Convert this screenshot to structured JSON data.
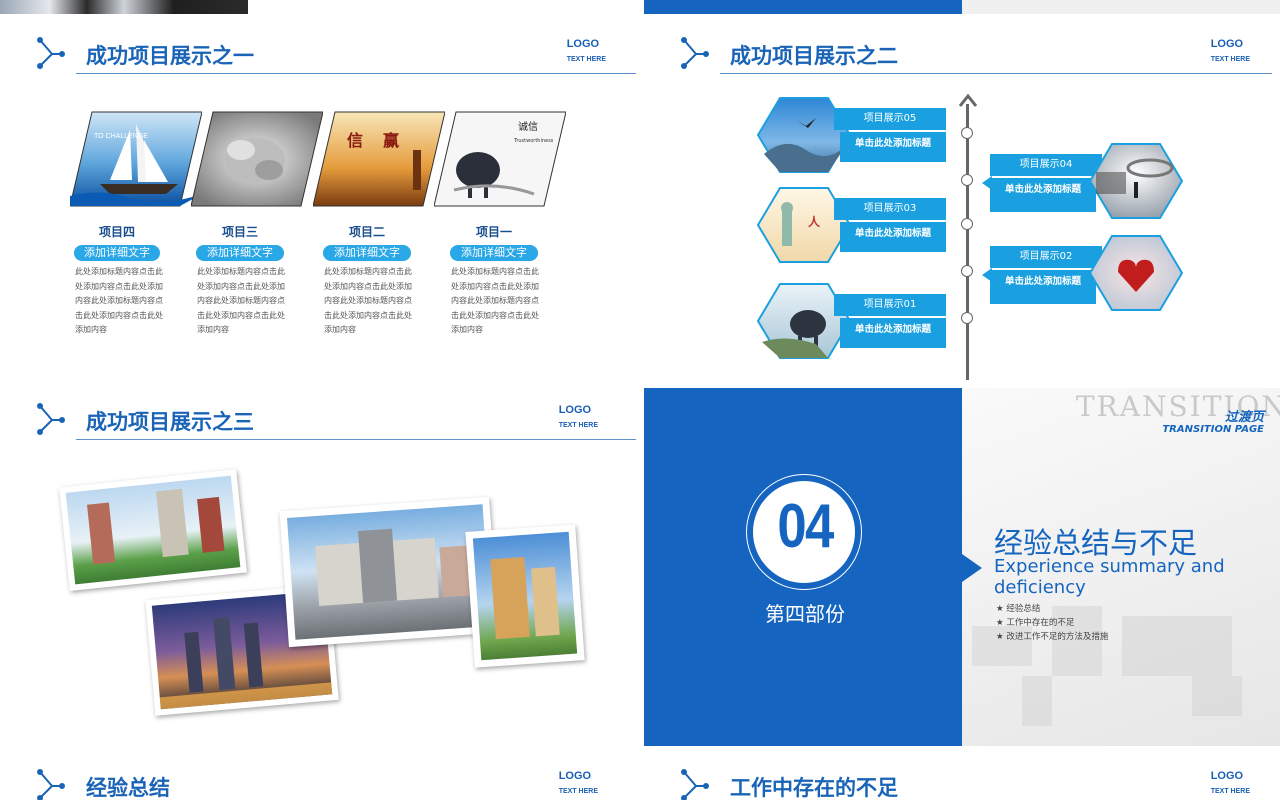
{
  "slide1": {
    "title": "成功项目展示之一",
    "logo": "LOGO",
    "logo_sub": "TEXT HERE",
    "items": [
      {
        "name": "项目四",
        "pill": "添加详细文字",
        "desc": "此处添加标题内容点击此处添加内容点击此处添加内容此处添加标题内容点击此处添加内容点击此处添加内容"
      },
      {
        "name": "项目三",
        "pill": "添加详细文字",
        "desc": "此处添加标题内容点击此处添加内容点击此处添加内容此处添加标题内容点击此处添加内容点击此处添加内容"
      },
      {
        "name": "项目二",
        "pill": "添加详细文字",
        "desc": "此处添加标题内容点击此处添加内容点击此处添加内容此处添加标题内容点击此处添加内容点击此处添加内容"
      },
      {
        "name": "项目一",
        "pill": "添加详细文字",
        "desc": "此处添加标题内容点击此处添加内容点击此处添加内容此处添加标题内容点击此处添加内容点击此处添加内容"
      }
    ],
    "image_texts": [
      "TO CHALLENGE",
      "Trustworthiness"
    ]
  },
  "slide2": {
    "title": "成功项目展示之二",
    "logo": "LOGO",
    "logo_sub": "TEXT HERE",
    "items": [
      {
        "label": "项目展示05",
        "sub": "单击此处添加标题"
      },
      {
        "label": "项目展示04",
        "sub": "单击此处添加标题"
      },
      {
        "label": "项目展示03",
        "sub": "单击此处添加标题"
      },
      {
        "label": "项目展示02",
        "sub": "单击此处添加标题"
      },
      {
        "label": "项目展示01",
        "sub": "单击此处添加标题"
      }
    ]
  },
  "slide3": {
    "title": "成功项目展示之三",
    "logo": "LOGO",
    "logo_sub": "TEXT HERE"
  },
  "slide4": {
    "number": "04",
    "part": "第四部份",
    "watermark": "TRANSITION",
    "page_label": "过渡页",
    "page_label_en": "TRANSITION PAGE",
    "heading_cn": "经验总结与不足",
    "heading_en": "Experience summary and deficiency",
    "bullets": [
      "经验总结",
      "工作中存在的不足",
      "改进工作不足的方法及措施"
    ],
    "colors": {
      "primary": "#1565c0",
      "accent": "#2aa7e6"
    }
  },
  "slide5": {
    "title": "经验总结",
    "logo": "LOGO",
    "logo_sub": "TEXT HERE"
  },
  "slide6": {
    "title": "工作中存在的不足",
    "logo": "LOGO",
    "logo_sub": "TEXT HERE"
  }
}
